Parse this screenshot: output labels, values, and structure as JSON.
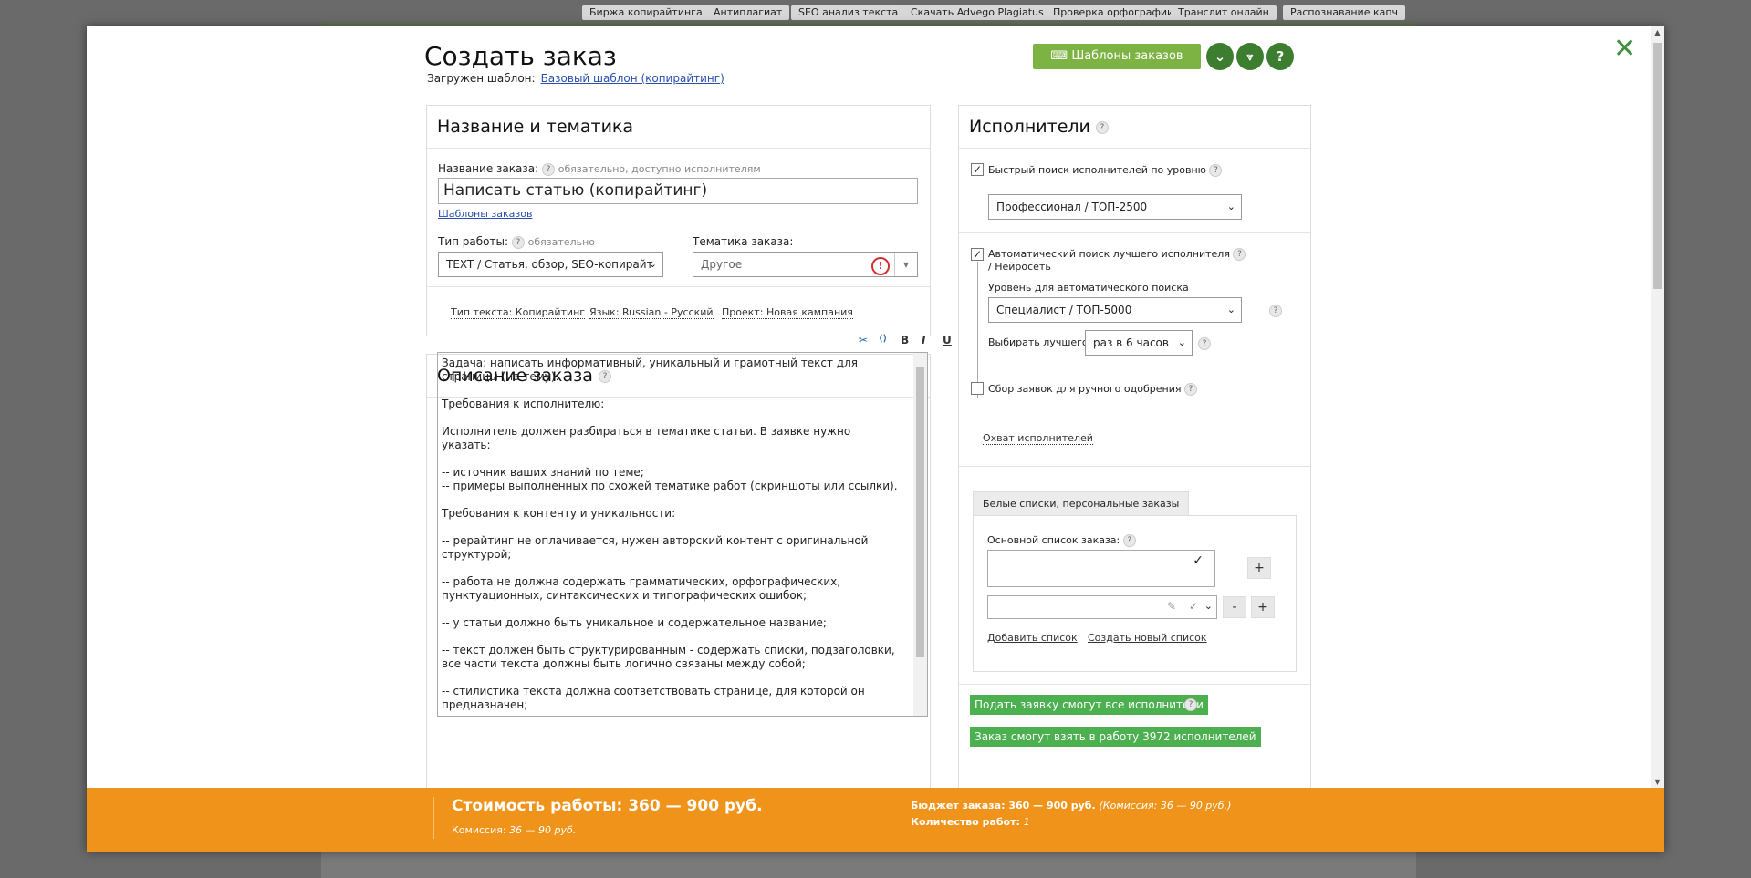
{
  "top_links": [
    "Биржа копирайтинга",
    "Антиплагиат",
    "SEO анализ текста",
    "Скачать Advego Plagiatus",
    "Проверка орфографии",
    "Транслит онлайн",
    "Распознавание капч"
  ],
  "header": {
    "title": "Создать заказ",
    "loaded_label": "Загружен шаблон:",
    "loaded_template": "Базовый шаблон (копирайтинг)",
    "templates_button": "Шаблоны заказов",
    "help_glyph": "?"
  },
  "colors": {
    "accent_green": "#7cb342",
    "dark_green": "#3d7d2f",
    "footer_orange": "#f0931b",
    "action_green": "#4caf50"
  },
  "name_panel": {
    "heading": "Название и тематика",
    "order_name_label": "Название заказа:",
    "order_name_hint": "обязательно, доступно исполнителям",
    "order_name_value": "Написать статью (копирайтинг)",
    "templates_link": "Шаблоны заказов",
    "work_type_label": "Тип работы:",
    "work_type_hint": "обязательно",
    "work_type_value": "TEXT / Статья, обзор, SEO-копирайт",
    "topic_label": "Тематика заказа:",
    "topic_value": "Другое",
    "meta_links": [
      "Тип текста: Копирайтинг",
      "Язык: Russian - Русский",
      "Проект: Новая кампания"
    ]
  },
  "description_panel": {
    "heading": "Описание заказа",
    "toolbar_icons": [
      "scissors-icon",
      "code-icon",
      "bold-icon",
      "italic-icon",
      "underline-icon",
      "strikethrough-icon"
    ],
    "text": "Задача: написать информативный, уникальный и грамотный текст для страницы (на тему):\n\nТребования к исполнителю:\n\nИсполнитель должен разбираться в тематике статьи. В заявке нужно указать:\n\n-- источник ваших знаний по теме;\n-- примеры выполненных по схожей тематике работ (скриншоты или ссылки).\n\nТребования к контенту и уникальности:\n\n-- рерайтинг не оплачивается, нужен авторский контент с оригинальной структурой;\n\n-- работа не должна содержать грамматических, орфографических, пунктуационных, синтаксических и типографических ошибок;\n\n-- у статьи должно быть уникальное и содержательное название;\n\n-- текст должен быть структурированным - содержать списки, подзаголовки, все части текста должны быть логично связаны между собой;\n\n-- стилистика текста должна соответствовать странице, для которой он предназначен;"
  },
  "performers_panel": {
    "heading": "Исполнители",
    "quick_search_label": "Быстрый поиск исполнителей по уровню",
    "quick_search_checked": true,
    "quick_level_value": "Профессионал / ТОП-2500",
    "auto_search_label_1": "Автоматический поиск лучшего исполнителя",
    "auto_search_label_2": "/ Нейросеть",
    "auto_search_checked": true,
    "auto_level_label": "Уровень для автоматического поиска",
    "auto_level_value": "Специалист / ТОП-5000",
    "choose_best_label": "Выбирать лучшего:",
    "choose_best_value": "раз в 6 часов",
    "manual_label": "Сбор заявок для ручного одобрения",
    "manual_checked": false,
    "coverage_link": "Охват исполнителей",
    "tab_label": "Белые списки, персональные заказы",
    "main_list_label": "Основной список заказа:",
    "plus": "+",
    "minus": "-",
    "add_list_link": "Добавить список",
    "create_list_link": "Создать новый список",
    "all_apply_button": "Подать заявку смогут все исполнители",
    "can_take_button": "Заказ смогут взять в работу 3972 исполнителей"
  },
  "footer": {
    "cost": "Стоимость работы: 360 — 900 руб.",
    "commission_label": "Комиссия:",
    "commission_value": "36 — 90 руб.",
    "budget": "Бюджет заказа: 360 — 900 руб.",
    "budget_commission": "(Комиссия: 36 — 90 руб.)",
    "count_label": "Количество работ:",
    "count_value": "1"
  }
}
